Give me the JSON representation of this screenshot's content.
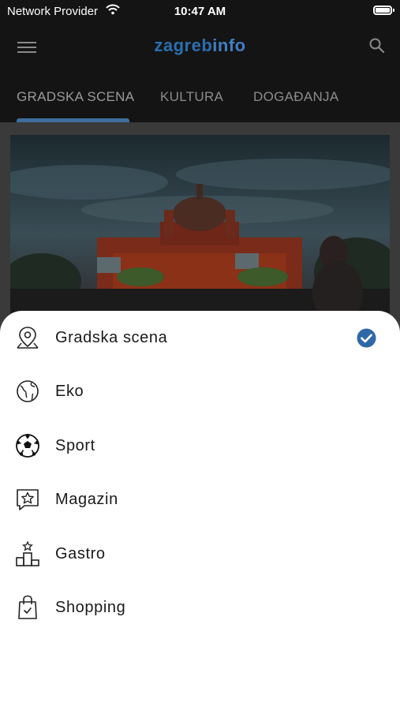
{
  "status_bar": {
    "carrier": "Network Provider",
    "time": "10:47 AM"
  },
  "header": {
    "logo_part1": "zagreb",
    "logo_part2": "info",
    "icons": [
      "menu-icon",
      "search-icon"
    ]
  },
  "tabs": {
    "items": [
      {
        "label": "GRADSKA SCENA",
        "active": true
      },
      {
        "label": "KULTURA",
        "active": false
      },
      {
        "label": "DOGAĐANJA",
        "active": false
      }
    ]
  },
  "categories": {
    "selected_index": 0,
    "items": [
      {
        "label": "Gradska scena",
        "icon": "map-pin-icon"
      },
      {
        "label": "Eko",
        "icon": "globe-icon"
      },
      {
        "label": "Sport",
        "icon": "soccer-ball-icon"
      },
      {
        "label": "Magazin",
        "icon": "star-speech-bubble-icon"
      },
      {
        "label": "Gastro",
        "icon": "podium-icon"
      },
      {
        "label": "Shopping",
        "icon": "shopping-bag-icon"
      }
    ]
  },
  "colors": {
    "accent": "#3e6f9e",
    "check": "#2f6aa8",
    "header_bg": "#141414",
    "sheet_bg": "#ffffff"
  }
}
